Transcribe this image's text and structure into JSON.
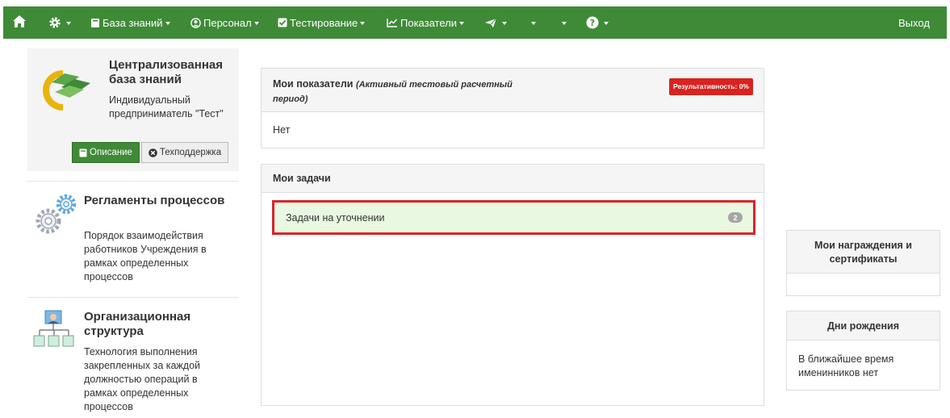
{
  "nav": {
    "knowledge_base": "База знаний",
    "personnel": "Персонал",
    "testing": "Тестирование",
    "indicators": "Показатели",
    "exit": "Выход",
    "color": "#3e8a37"
  },
  "brand": {
    "title": "Централизованная база знаний",
    "subtitle": "Индивидуальный предприниматель \"Тест\"",
    "description_button": "Описание",
    "support_button": "Техподдержка"
  },
  "left_items": [
    {
      "title": "Регламенты процессов",
      "description": "Порядок взаимодействия работников Учреждения в рамках определенных процессов",
      "icon": "gears-icon"
    },
    {
      "title": "Организационная структура",
      "description": "Технология выполнения закрепленных за каждой должностью операций в рамках определенных процессов",
      "icon": "org-structure-icon"
    }
  ],
  "performance": {
    "title": "Мои показатели",
    "period": "(Активный тестовый расчетный период)",
    "badge": "Результативность: 0%",
    "value": "Нет"
  },
  "tasks": {
    "title": "Мои задачи",
    "items": [
      {
        "label": "Задачи на уточнении",
        "count": "2"
      }
    ]
  },
  "awards": {
    "title": "Мои награждения и сертификаты"
  },
  "birthdays": {
    "title": "Дни рождения",
    "text": "В ближайшее время именинников нет"
  }
}
